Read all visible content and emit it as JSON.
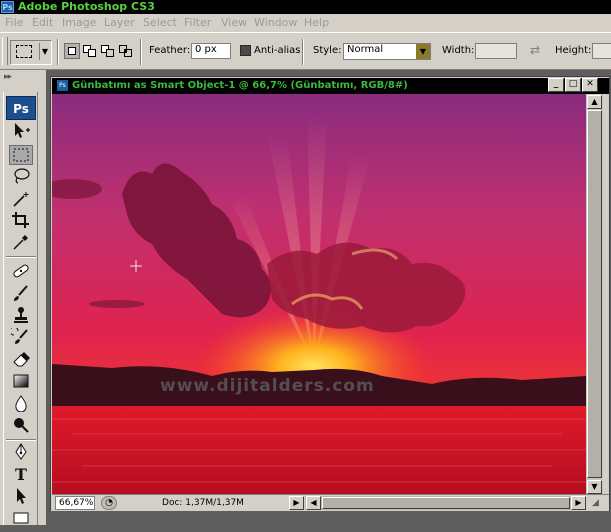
{
  "app": {
    "title": "Adobe Photoshop CS3",
    "icon_label": "Ps"
  },
  "menu": [
    "File",
    "Edit",
    "Image",
    "Layer",
    "Select",
    "Filter",
    "View",
    "Window",
    "Help"
  ],
  "options": {
    "feather_label": "Feather:",
    "feather_value": "0 px",
    "antialias_label": "Anti-alias",
    "style_label": "Style:",
    "style_value": "Normal",
    "width_label": "Width:",
    "height_label": "Height:"
  },
  "toolbox": {
    "logo": "Ps",
    "tools": [
      "move-tool",
      "rectangular-marquee-tool",
      "lasso-tool",
      "magic-wand-tool",
      "crop-tool",
      "eyedropper-tool",
      "healing-brush-tool",
      "brush-tool",
      "clone-stamp-tool",
      "history-brush-tool",
      "eraser-tool",
      "gradient-tool",
      "blur-tool",
      "dodge-tool",
      "pen-tool",
      "type-tool",
      "path-selection-tool",
      "rectangle-tool"
    ],
    "selected_tool": "rectangular-marquee-tool",
    "type_tool_glyph": "T"
  },
  "document": {
    "title": "Günbatımı as Smart Object-1 @ 66,7% (Günbatımı, RGB/8#)",
    "watermark": "www.dijitalders.com",
    "zoom": "66,67%",
    "doc_size": "Doc: 1,37M/1,37M"
  },
  "colors": {
    "app_title": "#58d240",
    "doc_title": "#3cb93c",
    "chrome": "#d4d0c8",
    "workspace": "#5e5e5e",
    "sky_top": "#8a2b7e",
    "sky_mid": "#e0234f",
    "sun": "#ffb21e",
    "water": "#d5132b"
  }
}
